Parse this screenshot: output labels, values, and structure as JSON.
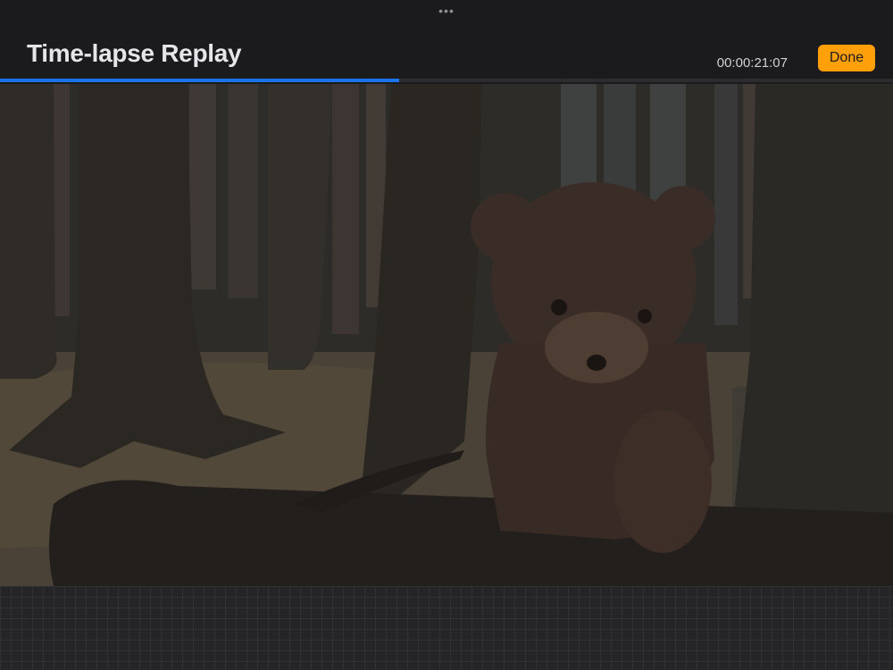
{
  "window": {
    "title": "Time-lapse Replay",
    "grabber_glyph": "•••"
  },
  "playback": {
    "elapsed": "00:00:21:07",
    "progress_fraction": 0.447
  },
  "actions": {
    "done_label": "Done"
  },
  "colors": {
    "accent_orange": "#ff9f0a",
    "progress_blue": "#1a73e8",
    "background": "#1b1b1d"
  },
  "icons": {
    "grabber": "more-dots-icon"
  }
}
